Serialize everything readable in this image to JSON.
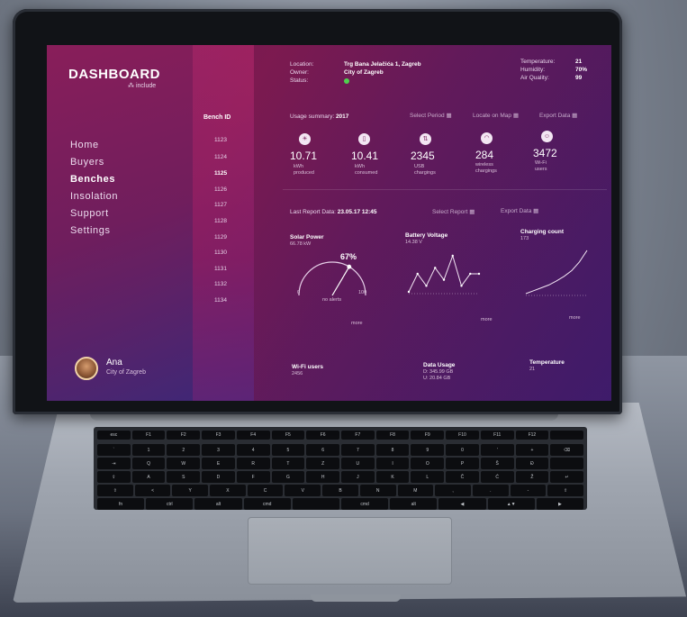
{
  "sidebar": {
    "logo": "DASHBOARD",
    "logo_sub": "include",
    "nav": [
      "Home",
      "Buyers",
      "Benches",
      "Insolation",
      "Support",
      "Settings"
    ],
    "active_nav": "Benches",
    "user": {
      "name": "Ana",
      "city": "City of Zagreb"
    }
  },
  "benches": {
    "header": "Bench ID",
    "ids": [
      "1123",
      "1124",
      "1125",
      "1126",
      "1127",
      "1128",
      "1129",
      "1130",
      "1131",
      "1132",
      "1134"
    ],
    "active_id": "1125"
  },
  "info": {
    "location_label": "Location:",
    "location_value": "Trg Bana Jelačića 1, Zagreb",
    "owner_label": "Owner:",
    "owner_value": "City of Zagreb",
    "status_label": "Status:",
    "status_color": "#4fd14f",
    "temperature_label": "Temperature:",
    "temperature_value": "21",
    "humidity_label": "Humidity:",
    "humidity_value": "70%",
    "air_label": "Air Quality:",
    "air_value": "99"
  },
  "usage": {
    "title": "Usage summary:",
    "year": "2017",
    "select_period": "Select Period",
    "locate_on_map": "Locate on Map",
    "export_data": "Export Data",
    "stats": [
      {
        "icon": "sun-icon",
        "value": "10.71",
        "unit1": "kWh",
        "unit2": "produced"
      },
      {
        "icon": "battery-icon",
        "value": "10.41",
        "unit1": "kWh",
        "unit2": "consumed"
      },
      {
        "icon": "usb-icon",
        "value": "2345",
        "unit1": "USB",
        "unit2": "chargings"
      },
      {
        "icon": "wifi-icon",
        "value": "284",
        "unit1": "wireless",
        "unit2": "chargings"
      },
      {
        "icon": "user-icon",
        "value": "3472",
        "unit1": "Wi-Fi",
        "unit2": "users"
      }
    ]
  },
  "report": {
    "label": "Last Report Data:",
    "value": "23.05.17 12:45",
    "select_report": "Select Report",
    "export_data": "Export Data"
  },
  "widgets": {
    "solar": {
      "title": "Solar Power",
      "sub": "66.78 kW",
      "percent": "67%",
      "gauge_fraction": 0.67,
      "note": "no alerts",
      "min": "0",
      "max": "100",
      "more": "more"
    },
    "battery": {
      "title": "Battery Voltage",
      "sub": "14.38 V",
      "more": "more",
      "values": [
        3,
        6,
        4,
        7,
        5,
        9,
        4,
        6,
        6
      ]
    },
    "charging": {
      "title": "Charging count",
      "sub": "173",
      "more": "more",
      "values": [
        1,
        1.5,
        2,
        2.5,
        3.2,
        4,
        5,
        6.5,
        8.5
      ]
    },
    "wifi": {
      "title": "Wi-Fi users",
      "sub": "2456"
    },
    "data_usage": {
      "title": "Data Usage",
      "line1": "D: 345.99 GB",
      "line2": "U: 20.84 GB"
    },
    "temperature": {
      "title": "Temperature",
      "sub": "21"
    }
  },
  "keyboard_rows": [
    [
      "esc",
      "F1",
      "F2",
      "F3",
      "F4",
      "F5",
      "F6",
      "F7",
      "F8",
      "F9",
      "F10",
      "F11",
      "F12",
      ""
    ],
    [
      "`",
      "1",
      "2",
      "3",
      "4",
      "5",
      "6",
      "7",
      "8",
      "9",
      "0",
      "'",
      "+",
      "⌫"
    ],
    [
      "⇥",
      "Q",
      "W",
      "E",
      "R",
      "T",
      "Z",
      "U",
      "I",
      "O",
      "P",
      "Š",
      "Đ",
      ""
    ],
    [
      "⇪",
      "A",
      "S",
      "D",
      "F",
      "G",
      "H",
      "J",
      "K",
      "L",
      "Č",
      "Ć",
      "Ž",
      "↵"
    ],
    [
      "⇧",
      "<",
      "Y",
      "X",
      "C",
      "V",
      "B",
      "N",
      "M",
      ",",
      ".",
      "-",
      "⇧"
    ],
    [
      "fn",
      "ctrl",
      "alt",
      "cmd",
      "",
      "cmd",
      "alt",
      "◀",
      "▲▼",
      "▶"
    ]
  ]
}
